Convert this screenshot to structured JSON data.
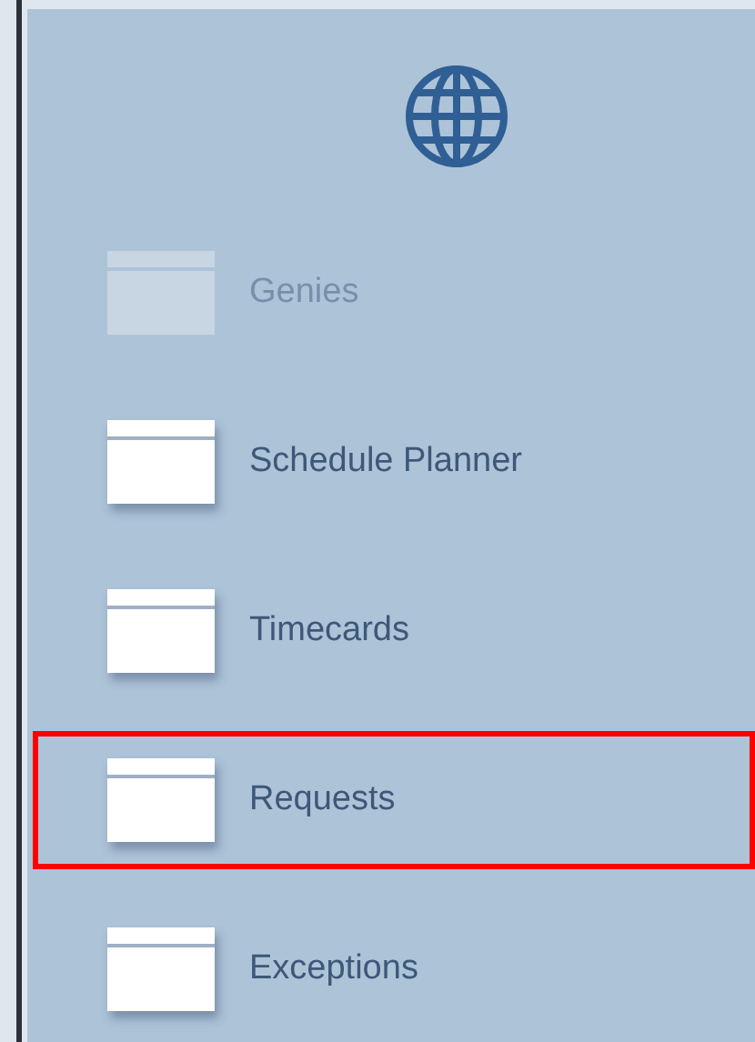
{
  "menu": [
    {
      "label": "Genies",
      "disabled": true,
      "highlighted": false
    },
    {
      "label": "Schedule Planner",
      "disabled": false,
      "highlighted": false
    },
    {
      "label": "Timecards",
      "disabled": false,
      "highlighted": false
    },
    {
      "label": "Requests",
      "disabled": false,
      "highlighted": true
    },
    {
      "label": "Exceptions",
      "disabled": false,
      "highlighted": false
    }
  ]
}
